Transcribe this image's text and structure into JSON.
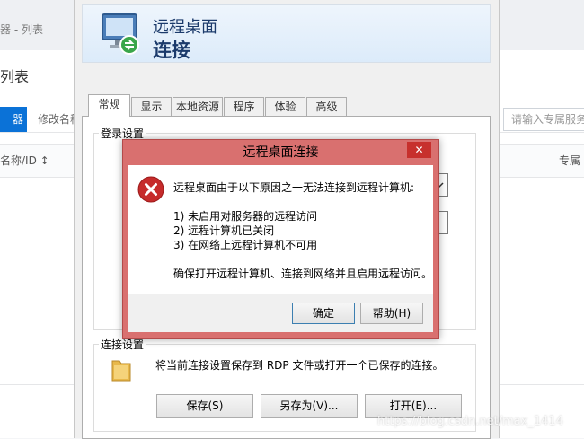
{
  "background": {
    "breadcrumb": "器 - 列表",
    "page_title": "列表",
    "active_tab": "器",
    "tab2": "修改名称",
    "search_placeholder": "请输入专属服务",
    "col1": "名称/ID ↕",
    "col2": "专属"
  },
  "rdp": {
    "title_line1": "远程桌面",
    "title_line2": "连接",
    "tabs": [
      "常规",
      "显示",
      "本地资源",
      "程序",
      "体验",
      "高级"
    ],
    "login_group": "登录设置",
    "connection_group": "连接设置",
    "connection_text": "将当前连接设置保存到 RDP 文件或打开一个已保存的连接。",
    "buttons": {
      "save": "保存(S)",
      "save_as": "另存为(V)...",
      "open": "打开(E)..."
    }
  },
  "dialog": {
    "title": "远程桌面连接",
    "close": "✕",
    "intro": "远程桌面由于以下原因之一无法连接到远程计算机:",
    "reasons": [
      "1) 未启用对服务器的远程访问",
      "2) 远程计算机已关闭",
      "3) 在网络上远程计算机不可用"
    ],
    "advice": "确保打开远程计算机、连接到网络并且启用远程访问。",
    "ok": "确定",
    "help": "帮助(H)"
  },
  "watermark": "https://blog.csdn.net/max_1414",
  "colors": {
    "console_accent": "#0b72d7",
    "dialog_frame": "#d9706f",
    "close_button": "#c7302d",
    "error_red": "#c62b2b",
    "rdp_title": "#1b3a6b"
  },
  "icons": [
    "rdp-monitor-icon",
    "error-icon",
    "folder-icon",
    "sort-icon",
    "dropdown-arrow-icon"
  ]
}
